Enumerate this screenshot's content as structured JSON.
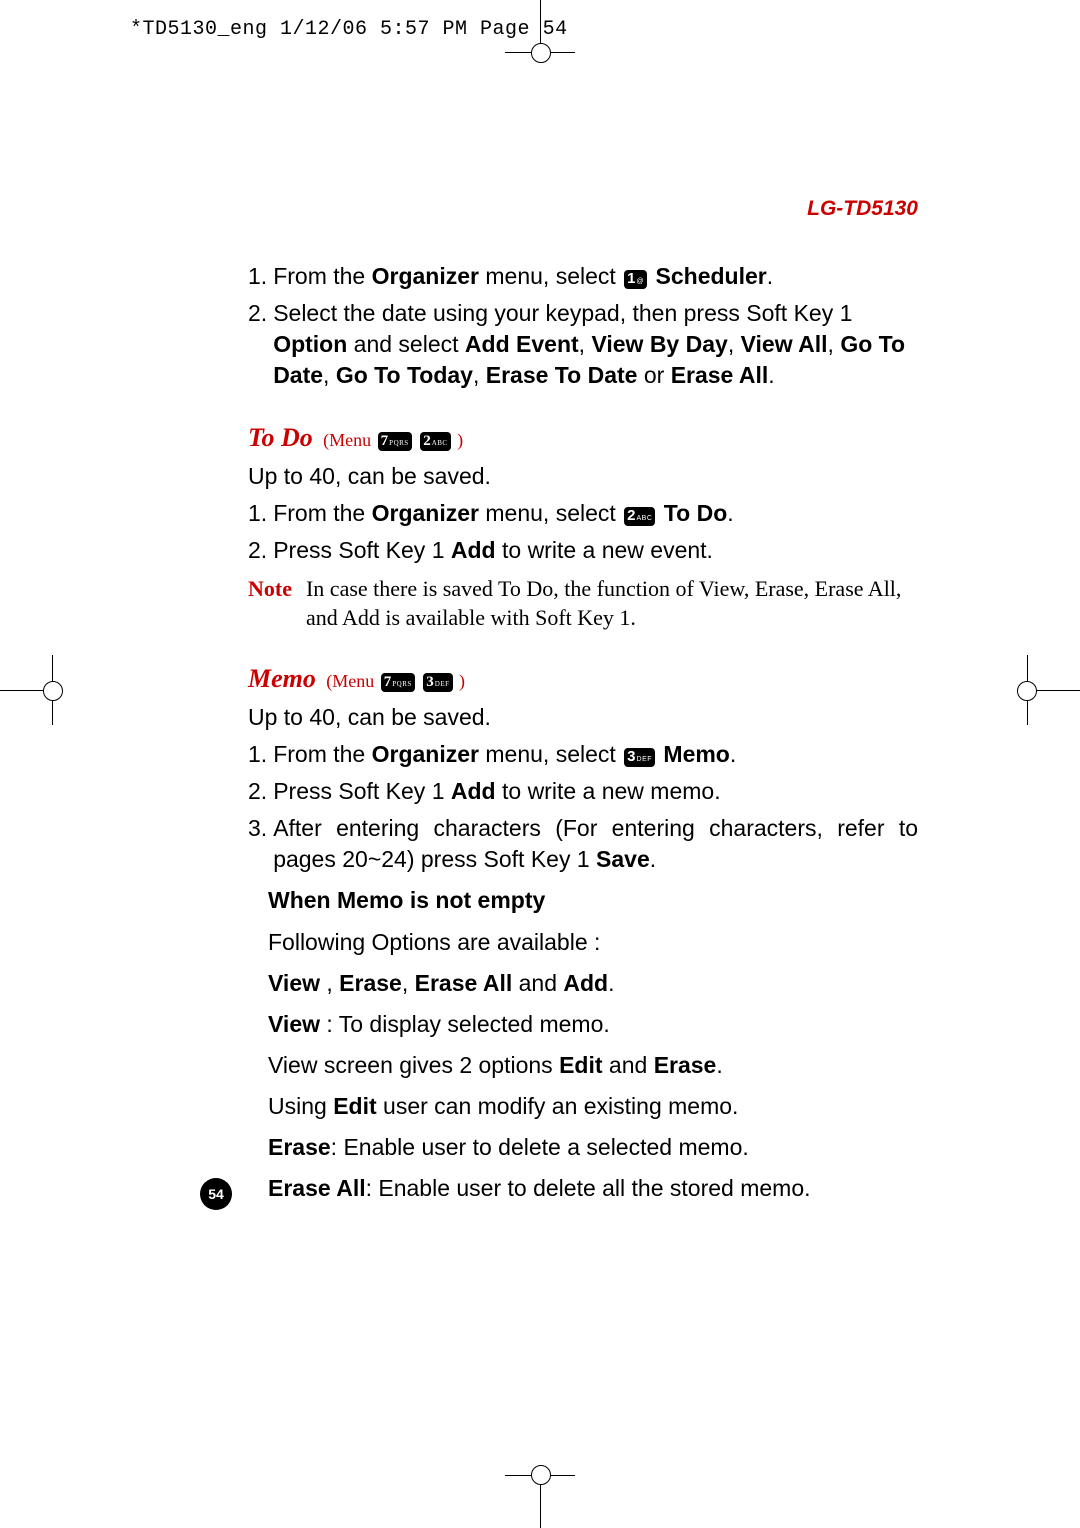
{
  "slug": "*TD5130_eng  1/12/06  5:57 PM  Page 54",
  "model": "LG-TD5130",
  "page_number": "54",
  "keys": {
    "k1": {
      "digit": "1",
      "label": "@"
    },
    "k2": {
      "digit": "2",
      "label": "ABC"
    },
    "k3": {
      "digit": "3",
      "label": "DEF"
    },
    "k7": {
      "digit": "7",
      "label": "PQRS"
    }
  },
  "top_steps": {
    "s1_num": "1.",
    "s1_pre": "From the ",
    "s1_bold1": "Organizer",
    "s1_mid": " menu, select ",
    "s1_bold2": " Scheduler",
    "s1_post": ".",
    "s2_num": "2.",
    "s2_l1": "Select the date using your keypad, then press Soft Key 1 ",
    "s2_b1": "Option",
    "s2_m1": " and select ",
    "s2_b2": "Add Event",
    "s2_m2": ", ",
    "s2_b3": "View By Day",
    "s2_m3": ", ",
    "s2_b4": "View All",
    "s2_m4": ", ",
    "s2_b5": "Go To Date",
    "s2_m5": ", ",
    "s2_b6": "Go To Today",
    "s2_m6": ", ",
    "s2_b7": "Erase To Date",
    "s2_m7": " or ",
    "s2_b8": "Erase All",
    "s2_post": "."
  },
  "todo": {
    "title": "To Do",
    "menu_label": "(Menu ",
    "menu_close": " )",
    "intro": "Up to 40, can be saved.",
    "s1_num": "1.",
    "s1_pre": "From the ",
    "s1_b1": "Organizer",
    "s1_mid": " menu, select ",
    "s1_b2": " To Do",
    "s1_post": ".",
    "s2_num": "2.",
    "s2_pre": "Press Soft Key 1 ",
    "s2_b1": "Add",
    "s2_post": " to write a new event.",
    "note_label": "Note",
    "note_text": "In case there is saved To Do, the function of View, Erase, Erase All, and Add is available with Soft Key 1."
  },
  "memo": {
    "title": "Memo",
    "menu_label": "(Menu ",
    "menu_close": " )",
    "intro": "Up to 40, can be saved.",
    "s1_num": "1.",
    "s1_pre": "From the ",
    "s1_b1": "Organizer",
    "s1_mid": " menu, select ",
    "s1_b2": " Memo",
    "s1_post": ".",
    "s2_num": "2.",
    "s2_pre": "Press Soft Key 1 ",
    "s2_b1": "Add",
    "s2_post": " to write a new memo.",
    "s3_num": "3.",
    "s3_pre": "After entering characters (For entering characters, refer to pages 20~24) press Soft Key 1 ",
    "s3_b1": "Save",
    "s3_post": ".",
    "sub_title": "When Memo is not empty",
    "sub_intro": "Following Options are available :",
    "sub_opts_b1": "View",
    "sub_opts_m1": " , ",
    "sub_opts_b2": "Erase",
    "sub_opts_m2": ", ",
    "sub_opts_b3": "Erase All",
    "sub_opts_m3": " and ",
    "sub_opts_b4": "Add",
    "sub_opts_post": ".",
    "view_b": "View",
    "view_t": " : To display selected memo.",
    "view_screen_pre": "View screen gives 2 options ",
    "view_screen_b1": "Edit",
    "view_screen_m": " and ",
    "view_screen_b2": "Erase",
    "view_screen_post": ".",
    "edit_pre": "Using ",
    "edit_b": "Edit",
    "edit_post": " user can modify an existing memo.",
    "erase_b": "Erase",
    "erase_t": ": Enable user to delete a selected memo.",
    "eraseall_b": "Erase All",
    "eraseall_t": ": Enable user to delete all the stored memo."
  }
}
